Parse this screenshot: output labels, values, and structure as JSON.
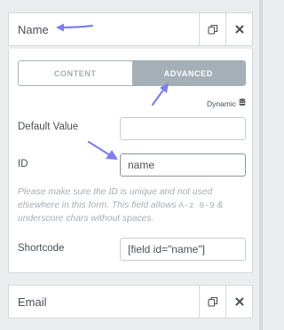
{
  "field_row_1": {
    "title": "Name"
  },
  "tabs": [
    {
      "label": "Content",
      "active": false
    },
    {
      "label": "Advanced",
      "active": true
    }
  ],
  "dynamic_label": "Dynamic",
  "default_value": {
    "label": "Default Value",
    "value": ""
  },
  "id_field": {
    "label": "ID",
    "value": "name"
  },
  "description": {
    "part1": "Please make sure the ID is unique and not used elsewhere in this form. This field allows ",
    "code1": "A-z 0-9",
    "part2": " & underscore chars without spaces."
  },
  "shortcode": {
    "label": "Shortcode",
    "value": "[field id=\"name\"]"
  },
  "field_row_2": {
    "title": "Email"
  },
  "colors": {
    "accent_arrow": "#7b7ff3",
    "tab_active": "#a4afb7",
    "border": "#d5d8dc"
  }
}
